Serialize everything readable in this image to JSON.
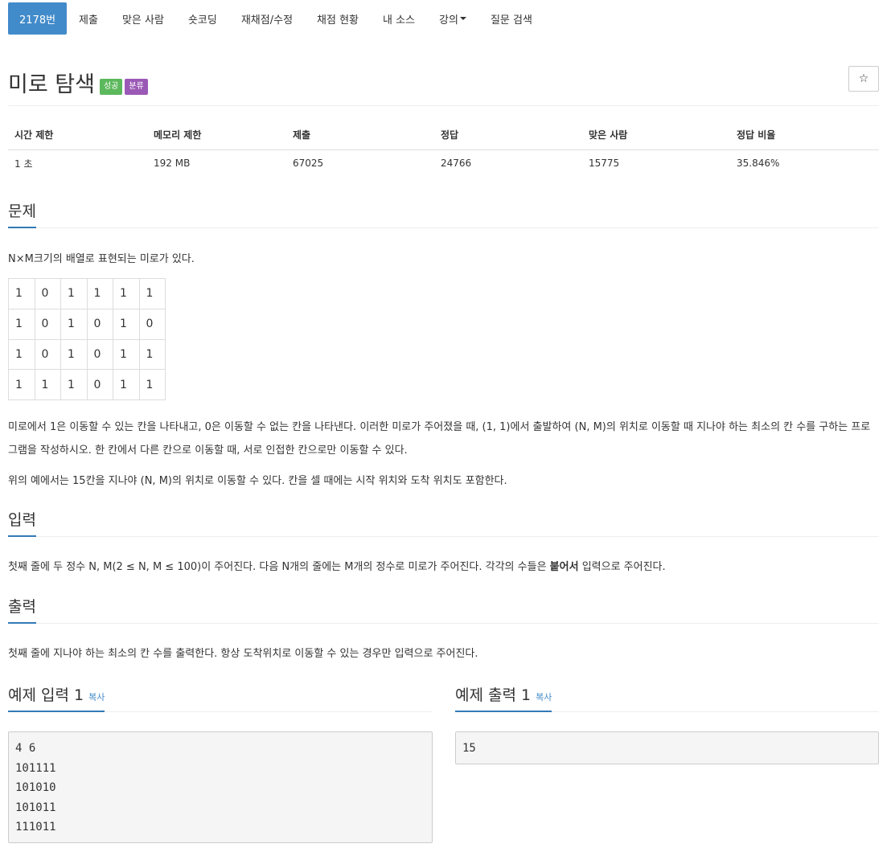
{
  "nav": {
    "items": [
      {
        "label": "2178번",
        "active": true
      },
      {
        "label": "제출"
      },
      {
        "label": "맞은 사람"
      },
      {
        "label": "숏코딩"
      },
      {
        "label": "재채점/수정"
      },
      {
        "label": "채점 현황"
      },
      {
        "label": "내 소스"
      },
      {
        "label": "강의",
        "dropdown": true
      },
      {
        "label": "질문 검색"
      }
    ]
  },
  "problem": {
    "title": "미로 탐색",
    "badge_success": "성공",
    "badge_category": "분류",
    "star_icon": "☆"
  },
  "info": {
    "headers": [
      "시간 제한",
      "메모리 제한",
      "제출",
      "정답",
      "맞은 사람",
      "정답 비율"
    ],
    "values": [
      "1 초",
      "192 MB",
      "67025",
      "24766",
      "15775",
      "35.846%"
    ]
  },
  "sections": {
    "problem_heading": "문제",
    "problem_intro": "N×M크기의 배열로 표현되는 미로가 있다.",
    "maze": [
      [
        "1",
        "0",
        "1",
        "1",
        "1",
        "1"
      ],
      [
        "1",
        "0",
        "1",
        "0",
        "1",
        "0"
      ],
      [
        "1",
        "0",
        "1",
        "0",
        "1",
        "1"
      ],
      [
        "1",
        "1",
        "1",
        "0",
        "1",
        "1"
      ]
    ],
    "problem_desc1": "미로에서 1은 이동할 수 있는 칸을 나타내고, 0은 이동할 수 없는 칸을 나타낸다. 이러한 미로가 주어졌을 때, (1, 1)에서 출발하여 (N, M)의 위치로 이동할 때 지나야 하는 최소의 칸 수를 구하는 프로그램을 작성하시오. 한 칸에서 다른 칸으로 이동할 때, 서로 인접한 칸으로만 이동할 수 있다.",
    "problem_desc2": "위의 예에서는 15칸을 지나야 (N, M)의 위치로 이동할 수 있다. 칸을 셀 때에는 시작 위치와 도착 위치도 포함한다.",
    "input_heading": "입력",
    "input_text_before": "첫째 줄에 두 정수 N, M(2 ≤ N, M ≤ 100)이 주어진다. 다음 N개의 줄에는 M개의 정수로 미로가 주어진다. 각각의 수들은 ",
    "input_text_bold": "붙어서",
    "input_text_after": " 입력으로 주어진다.",
    "output_heading": "출력",
    "output_text": "첫째 줄에 지나야 하는 최소의 칸 수를 출력한다. 항상 도착위치로 이동할 수 있는 경우만 입력으로 주어진다."
  },
  "samples": {
    "input_heading": "예제 입력 1",
    "output_heading": "예제 출력 1",
    "copy_label": "복사",
    "input": "4 6\n101111\n101010\n101011\n111011",
    "output": "15"
  }
}
